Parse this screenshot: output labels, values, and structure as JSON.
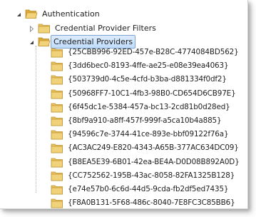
{
  "tree": {
    "root": {
      "label": "Authentication",
      "expanded": true,
      "icon": "folder-open-icon"
    },
    "children": [
      {
        "label": "Credential Provider Filters",
        "expanded": false,
        "selected": false,
        "icon": "folder-icon"
      },
      {
        "label": "Credential Providers",
        "expanded": true,
        "selected": true,
        "icon": "folder-open-icon"
      }
    ],
    "providers": [
      "{25CBB996-92ED-457e-B28C-4774084BD562}",
      "{3dd6bec0-8193-4ffe-ae25-e08e39ea4063}",
      "{503739d0-4c5e-4cfd-b3ba-d881334f0df2}",
      "{50968FF7-10C1-4fb3-98B0-CD654D6CB97E}",
      "{6f45dc1e-5384-457a-bc13-2cd81b0d28ed}",
      "{8bf9a910-a8ff-457f-999f-a5ca10b4a885}",
      "{94596c7e-3744-41ce-893e-bbf09122f76a}",
      "{AC3AC249-E820-4343-A65B-377AC634DC09}",
      "{B8EA5E39-6B01-42ea-BE4A-D0D08B892A0D}",
      "{CC752562-195B-43ac-8058-82FA1325B128}",
      "{e74e57b0-6c6d-44d5-9cda-fb2df5ed7435}",
      "{F8A0B131-5F68-486c-8040-7E8FC3C85BB6}"
    ]
  },
  "colors": {
    "folder": "#e8c25a",
    "selection_bg": "#cde3fb",
    "selection_border": "#7da2ce"
  }
}
